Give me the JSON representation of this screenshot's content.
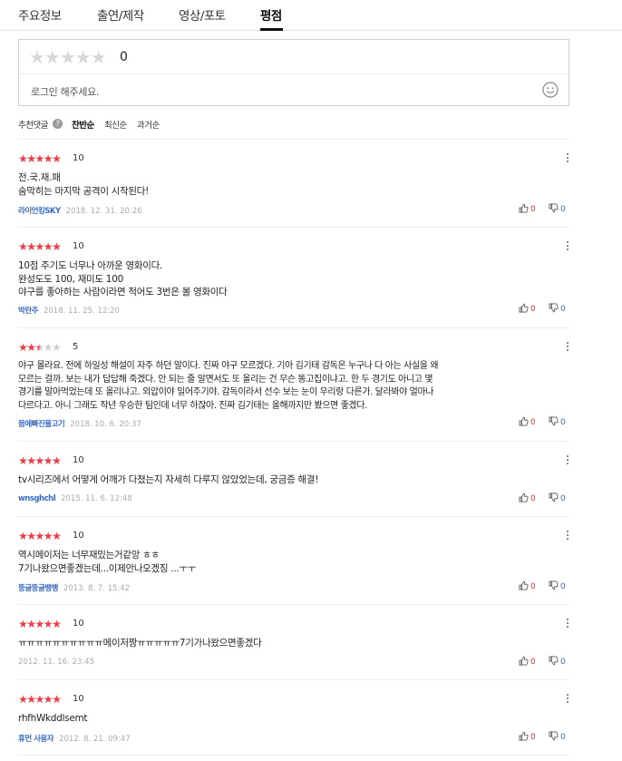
{
  "tabs": [
    {
      "label": "주요정보"
    },
    {
      "label": "출연/제작"
    },
    {
      "label": "영상/포토"
    },
    {
      "label": "평점"
    }
  ],
  "rating_box": {
    "score": "0",
    "login_prompt": "로그인 해주세요."
  },
  "sort": {
    "recommended": "추천댓글",
    "help": "?",
    "options": [
      "찬반순",
      "최신순",
      "과거순"
    ]
  },
  "reviews": [
    {
      "stars": 5,
      "score": "10",
      "lines": [
        "전.국.재.패",
        "숨막히는 마지막 공격이 시작된다!"
      ],
      "user": "라이언킹SKY",
      "date": "2018. 12. 31. 20:26",
      "up": "0",
      "down": "0"
    },
    {
      "stars": 5,
      "score": "10",
      "lines": [
        "10점 주기도 너무나 아까운 영화이다.",
        "완성도도 100, 재미도 100",
        "야구를 좋아하는 사람이라면 적어도 3번은 볼 영화이다"
      ],
      "user": "박란주",
      "date": "2018. 11. 25. 12:20",
      "up": "0",
      "down": "0"
    },
    {
      "stars": 2.5,
      "score": "5",
      "lines": [
        "야구 몰라요. 전에 하일성 해설이 자주 하던 말이다. 진짜 야구 모르겠다. 기아 김기태 감독은 누구나 다 아는 사실을 왜",
        "모르는 걸까. 보는 내가 답답해 죽겠다. 안 되는 줄 알면서도 또 올리는 건 무슨 똥고집이냐고. 한 두 경기도 아니고 몇",
        "경기를 말아먹었는데 또 올리냐고. 외압이야 밀어주기야. 감독이라서 선수 보는 눈이 우리랑 다른가. 달라봐야 얼마나",
        "다르다고. 아니 그래도 작년 우승한 팀인데 너무 하잖아. 진짜 김기태는 올해까지만 봤으면 좋겠다."
      ],
      "user": "몸에빠진물고기",
      "date": "2018. 10. 6. 20:37",
      "up": "0",
      "down": "0"
    },
    {
      "stars": 5,
      "score": "10",
      "lines": [
        "tv시리즈에서 어떻게 어깨가 다쳤는지 자세히 다루지 않았었는데, 궁금증 해결!"
      ],
      "user": "wnsghchl",
      "date": "2015. 11. 6. 12:48",
      "up": "0",
      "down": "0"
    },
    {
      "stars": 5,
      "score": "10",
      "lines": [
        "역시메이저는 너무재밌는거같앙 ㅎㅎ",
        "7기나왔으면좋겠는데...이제안나오겠징 ...ㅜㅜ"
      ],
      "user": "뚱글뚱글뱅뱅",
      "date": "2013. 8. 7. 15:42",
      "up": "0",
      "down": "0"
    },
    {
      "stars": 5,
      "score": "10",
      "lines": [
        "ㅠㅠㅠㅠㅠㅠㅠㅠㅠㅠ메이저짱ㅠㅠㅠㅠㅠ7기가나왔으면좋겠다"
      ],
      "user": "",
      "date": "2012. 11. 16. 23:45",
      "up": "0",
      "down": "0"
    },
    {
      "stars": 5,
      "score": "10",
      "lines": [
        "rhfhWkddlsemt"
      ],
      "user": "휴먼 사용자",
      "date": "2012. 8. 21. 09:47",
      "up": "0",
      "down": "0"
    }
  ],
  "colors": {
    "star_on": "#f03a45",
    "star_off": "#cfcfcf",
    "username": "#3a6ac4",
    "upvote": "#e0323c",
    "downvote": "#3a6ac4"
  }
}
